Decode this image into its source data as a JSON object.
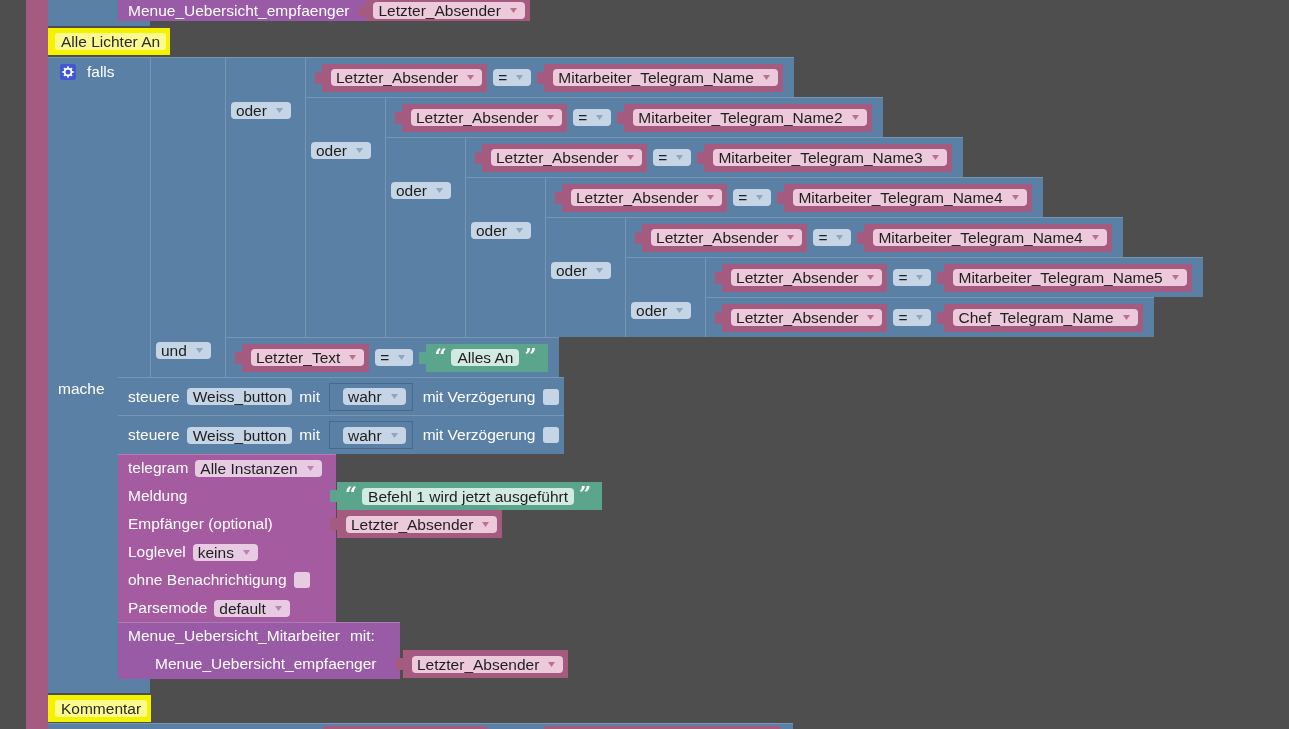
{
  "stack": [
    {
      "kind": "call_tail",
      "parameter": "Menue_Uebersicht_empfaenger",
      "argument": {
        "kind": "variable",
        "name": "Letzter_Absender"
      }
    },
    {
      "kind": "comment",
      "text": "Alle Lichter An"
    },
    {
      "kind": "if",
      "label": "falls",
      "condition": {
        "kind": "logic",
        "operator": "und",
        "a": {
          "kind": "logic",
          "operator": "oder",
          "a": {
            "kind": "compare",
            "left": {
              "kind": "variable",
              "name": "Letzter_Absender"
            },
            "operator": "=",
            "right": {
              "kind": "variable",
              "name": "Mitarbeiter_Telegram_Name"
            }
          },
          "b": {
            "kind": "logic",
            "operator": "oder",
            "a": {
              "kind": "compare",
              "left": {
                "kind": "variable",
                "name": "Letzter_Absender"
              },
              "operator": "=",
              "right": {
                "kind": "variable",
                "name": "Mitarbeiter_Telegram_Name2"
              }
            },
            "b": {
              "kind": "logic",
              "operator": "oder",
              "a": {
                "kind": "compare",
                "left": {
                  "kind": "variable",
                  "name": "Letzter_Absender"
                },
                "operator": "=",
                "right": {
                  "kind": "variable",
                  "name": "Mitarbeiter_Telegram_Name3"
                }
              },
              "b": {
                "kind": "logic",
                "operator": "oder",
                "a": {
                  "kind": "compare",
                  "left": {
                    "kind": "variable",
                    "name": "Letzter_Absender"
                  },
                  "operator": "=",
                  "right": {
                    "kind": "variable",
                    "name": "Mitarbeiter_Telegram_Name4"
                  }
                },
                "b": {
                  "kind": "logic",
                  "operator": "oder",
                  "a": {
                    "kind": "compare",
                    "left": {
                      "kind": "variable",
                      "name": "Letzter_Absender"
                    },
                    "operator": "=",
                    "right": {
                      "kind": "variable",
                      "name": "Mitarbeiter_Telegram_Name4"
                    }
                  },
                  "b": {
                    "kind": "logic",
                    "operator": "oder",
                    "a": {
                      "kind": "compare",
                      "left": {
                        "kind": "variable",
                        "name": "Letzter_Absender"
                      },
                      "operator": "=",
                      "right": {
                        "kind": "variable",
                        "name": "Mitarbeiter_Telegram_Name5"
                      }
                    },
                    "b": {
                      "kind": "compare",
                      "left": {
                        "kind": "variable",
                        "name": "Letzter_Absender"
                      },
                      "operator": "=",
                      "right": {
                        "kind": "variable",
                        "name": "Chef_Telegram_Name"
                      }
                    }
                  }
                }
              }
            }
          }
        },
        "b": {
          "kind": "compare",
          "left": {
            "kind": "variable",
            "name": "Letzter_Text"
          },
          "operator": "=",
          "right": {
            "kind": "text",
            "open": "“",
            "value": "Alles An",
            "close": "”"
          }
        }
      },
      "do_label": "mache",
      "statements": [
        {
          "kind": "control",
          "label": "steuere",
          "device": "Weiss_button",
          "with_label": "mit",
          "value": {
            "kind": "boolean",
            "value": "wahr"
          },
          "delay_label": "mit Verzögerung",
          "delay": false
        },
        {
          "kind": "control",
          "label": "steuere",
          "device": "Weiss_button",
          "with_label": "mit",
          "value": {
            "kind": "boolean",
            "value": "wahr"
          },
          "delay_label": "mit Verzögerung",
          "delay": false
        },
        {
          "kind": "telegram",
          "rows": [
            {
              "kind": "dropdown",
              "label": "telegram",
              "value": "Alle Instanzen"
            },
            {
              "kind": "input",
              "label": "Meldung",
              "input": {
                "kind": "text",
                "open": "“",
                "value": "Befehl 1 wird jetzt ausgeführt",
                "close": "”"
              }
            },
            {
              "kind": "input",
              "label": "Empfänger (optional)",
              "input": {
                "kind": "variable",
                "name": "Letzter_Absender"
              }
            },
            {
              "kind": "dropdown",
              "label": "Loglevel",
              "value": "keins"
            },
            {
              "kind": "checkbox",
              "label": "ohne Benachrichtigung",
              "checked": false
            },
            {
              "kind": "dropdown",
              "label": "Parsemode",
              "value": "default"
            }
          ]
        },
        {
          "kind": "procedure_call",
          "name": "Menue_Uebersicht_Mitarbeiter",
          "with_label": "mit:",
          "parameters": [
            {
              "name": "Menue_Uebersicht_empfaenger",
              "argument": {
                "kind": "variable",
                "name": "Letzter_Absender"
              }
            }
          ]
        }
      ]
    },
    {
      "kind": "comment",
      "text": "Kommentar"
    },
    {
      "kind": "if_partial"
    }
  ]
}
